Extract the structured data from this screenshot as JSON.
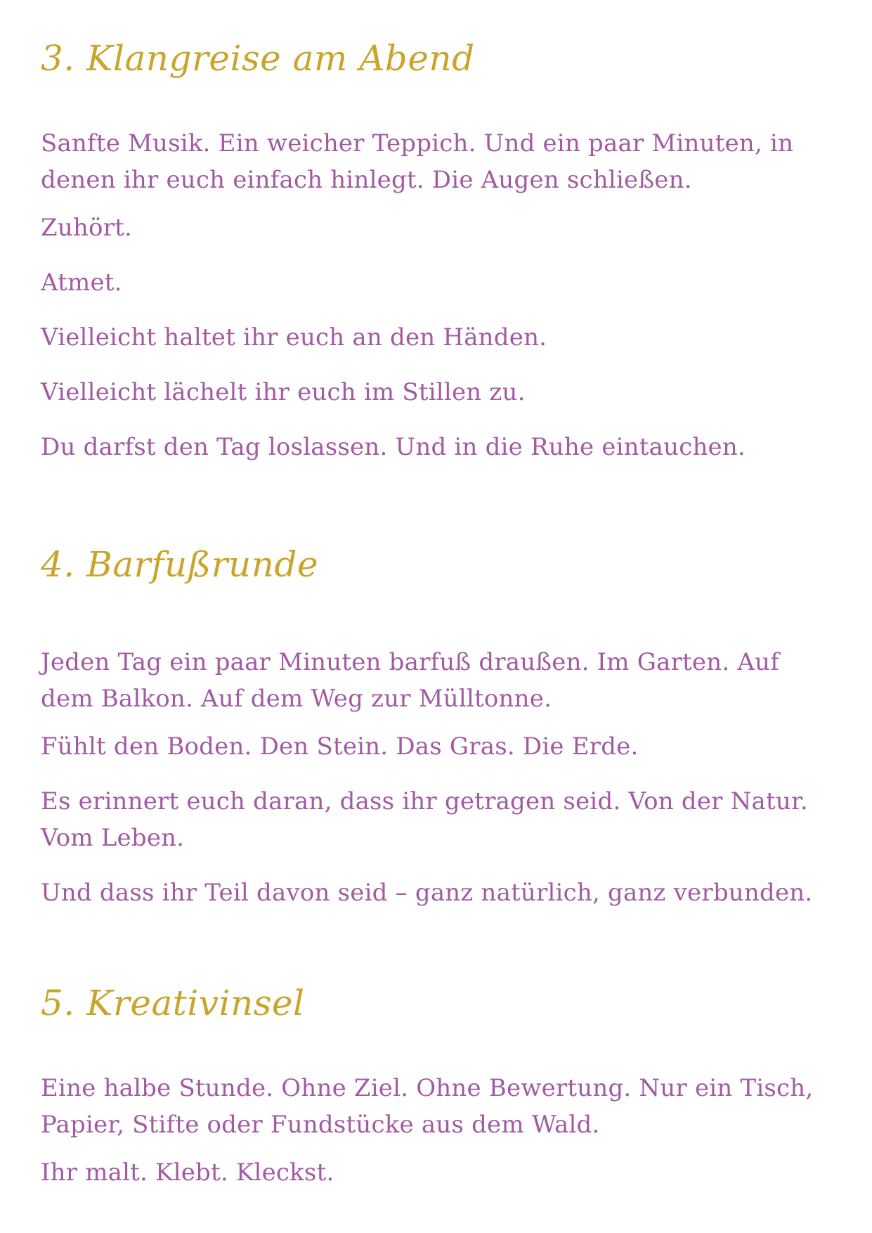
{
  "sections": [
    {
      "heading": "3. Klangreise am Abend",
      "paragraphs": [
        "Sanfte Musik. Ein weicher Teppich. Und ein paar Minuten, in denen ihr euch einfach hinlegt. Die Augen schließen.",
        "Zuhört.",
        "Atmet.",
        "Vielleicht haltet ihr euch an den Händen.",
        "Vielleicht lächelt ihr euch im Stillen zu.",
        "Du darfst den Tag loslassen. Und in die Ruhe eintauchen."
      ]
    },
    {
      "heading": "4. Barfußrunde",
      "paragraphs": [
        "Jeden Tag ein paar Minuten barfuß draußen. Im Garten. Auf dem Balkon. Auf dem Weg zur Mülltonne.",
        "Fühlt den Boden. Den Stein. Das Gras. Die Erde.",
        "Es erinnert euch daran, dass ihr getragen seid. Von der Natur. Vom Leben.",
        "Und dass ihr Teil davon seid – ganz natürlich, ganz verbunden."
      ]
    },
    {
      "heading": "5. Kreativinsel",
      "paragraphs": [
        "Eine halbe Stunde. Ohne Ziel. Ohne Bewertung. Nur ein Tisch, Papier, Stifte oder Fundstücke aus dem Wald.",
        "Ihr malt. Klebt. Kleckst."
      ]
    }
  ],
  "colors": {
    "heading": "#c9a52c",
    "body": "#a25aa3",
    "background": "#ffffff"
  }
}
